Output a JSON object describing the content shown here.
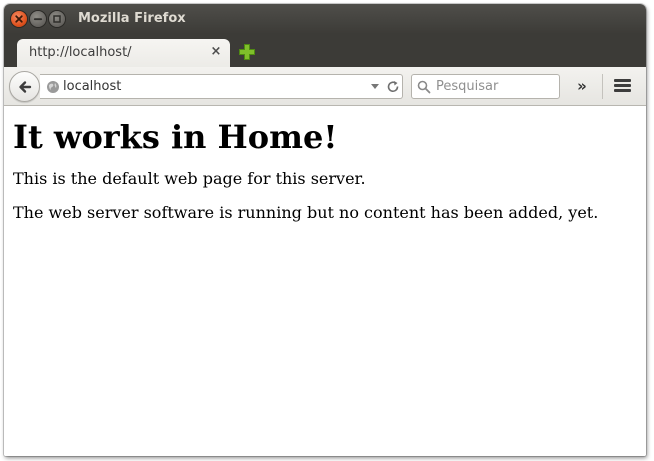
{
  "window": {
    "title": "Mozilla Firefox"
  },
  "tabs": [
    {
      "title": "http://localhost/",
      "close_glyph": "×"
    }
  ],
  "newtab": {
    "icon": "plus-icon"
  },
  "navbar": {
    "url": "localhost",
    "search_placeholder": "Pesquisar",
    "overflow_glyph": "»"
  },
  "page": {
    "heading": "It works in Home!",
    "paragraphs": [
      "This is the default web page for this server.",
      "The web server software is running but no content has been added, yet."
    ]
  },
  "colors": {
    "titlebar": "#3c3b37",
    "close_button": "#e0531f",
    "newtab_plus": "#7fbf2a"
  }
}
